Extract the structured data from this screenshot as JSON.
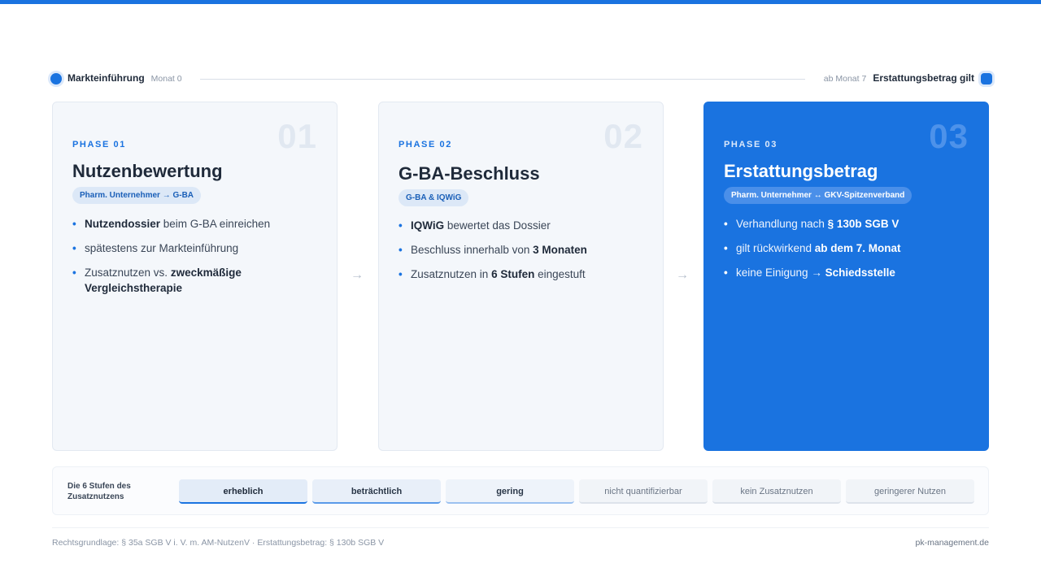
{
  "colors": {
    "accent": "#1a73e0",
    "card_bg": "#f4f7fb",
    "muted": "#8a95a5"
  },
  "timeline": {
    "start_label": "Markteinführung",
    "start_sub": "Monat 0",
    "end_sub": "ab Monat 7",
    "end_label": "Erstattungsbetrag gilt"
  },
  "phases": [
    {
      "number": "01",
      "label": "PHASE 01",
      "title": "Nutzenbewertung",
      "pill": "Pharm. Unternehmer → G-BA",
      "bullets": [
        {
          "bold": "Nutzendossier",
          "text": " beim G-BA einreichen"
        },
        {
          "text": "spätestens zur Markteinführung"
        },
        {
          "text": "Zusatznutzen vs. ",
          "bold": "zweckmäßige Vergleichstherapie"
        }
      ]
    },
    {
      "number": "02",
      "label": "PHASE 02",
      "title": "G-BA-Beschluss",
      "pill": "G-BA & IQWiG",
      "bullets": [
        {
          "bold": "IQWiG",
          "text": " bewertet das Dossier"
        },
        {
          "text": "Beschluss innerhalb von ",
          "bold": "3 Monaten"
        },
        {
          "text": "Zusatznutzen in ",
          "bold": "6 Stufen",
          "text2": " eingestuft"
        }
      ]
    },
    {
      "number": "03",
      "label": "PHASE 03",
      "title": "Erstattungsbetrag",
      "pill": "Pharm. Unternehmer ↔ GKV-Spitzenverband",
      "bullets": [
        {
          "text": "Verhandlung nach ",
          "bold": "§ 130b SGB V"
        },
        {
          "text": "gilt rückwirkend ",
          "bold": "ab dem 7. Monat"
        },
        {
          "text": "keine Einigung → ",
          "bold": "Schiedsstelle"
        }
      ]
    }
  ],
  "stages": {
    "label": "Die 6 Stufen des Zusatznutzens",
    "items": [
      "erheblich",
      "beträchtlich",
      "gering",
      "nicht quantifizierbar",
      "kein Zusatznutzen",
      "geringerer Nutzen"
    ]
  },
  "footer": {
    "left": "Rechtsgrundlage: § 35a SGB V i. V. m. AM-NutzenV · Erstattungsbetrag: § 130b SGB V",
    "right": "pk-management.de"
  }
}
